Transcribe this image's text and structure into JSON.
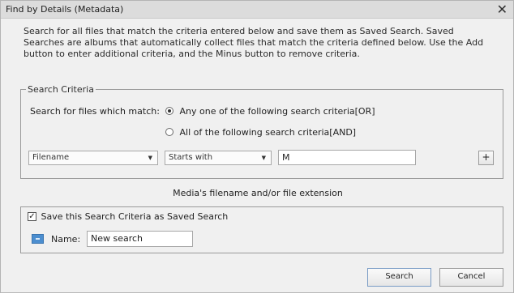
{
  "dialog": {
    "title": "Find by Details (Metadata)",
    "close_glyph": "✕",
    "description": "Search for all files that match the criteria entered below and save them as Saved Search. Saved Searches are albums that automatically collect files that match the criteria defined below. Use the Add button to enter additional criteria, and the Minus button to remove criteria."
  },
  "criteria": {
    "legend": "Search Criteria",
    "match_label": "Search for files which match:",
    "options": [
      {
        "label": "Any one of the following search criteria[OR]",
        "selected": true
      },
      {
        "label": "All of the following search criteria[AND]",
        "selected": false
      }
    ],
    "rule": {
      "field": "Filename",
      "operator": "Starts with",
      "value": "M",
      "add_label": "+"
    },
    "hint": "Media's filename and/or file extension"
  },
  "saved": {
    "checkbox_label": "Save this Search Criteria as Saved Search",
    "checked": true,
    "check_glyph": "✓",
    "name_label": "Name:",
    "name_value": "New search"
  },
  "buttons": {
    "search": "Search",
    "cancel": "Cancel"
  }
}
